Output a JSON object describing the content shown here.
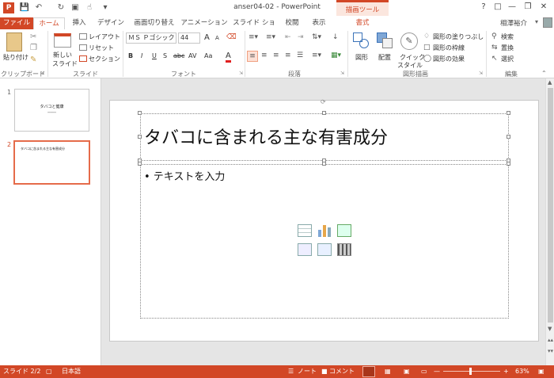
{
  "title": "anser04-02 - PowerPoint",
  "context_tab": "描画ツール",
  "tabs": [
    "ファイル",
    "ホーム",
    "挿入",
    "デザイン",
    "画面切り替え",
    "アニメーション",
    "スライド ショー",
    "校閲",
    "表示",
    "書式"
  ],
  "user": "相澤裕介",
  "ribbon": {
    "clipboard": {
      "paste": "貼り付け",
      "label": "クリップボード"
    },
    "slides": {
      "new_slide_1": "新しい",
      "new_slide_2": "スライド",
      "layout": "レイアウト",
      "reset": "リセット",
      "section": "セクション",
      "label": "スライド"
    },
    "font": {
      "font_name": "ＭＳ Ｐゴシック",
      "font_size": "44",
      "bold": "B",
      "italic": "I",
      "underline": "U",
      "shadow": "S",
      "strike": "abc",
      "spacing": "AV",
      "case": "Aa",
      "color": "A",
      "grow": "A",
      "shrink": "A",
      "label": "フォント"
    },
    "paragraph": {
      "label": "段落"
    },
    "drawing": {
      "shapes": "図形",
      "arrange": "配置",
      "quick_1": "クイック",
      "quick_2": "スタイル",
      "fill": "図形の塗りつぶし",
      "outline": "図形の枠線",
      "effect": "図形の効果",
      "label": "図形描画"
    },
    "editing": {
      "find": "検索",
      "replace": "置換",
      "select": "選択",
      "label": "編集"
    }
  },
  "slides": [
    {
      "num": "1",
      "title": "タバコと健康",
      "sub": "━━━━━━"
    },
    {
      "num": "2",
      "title": "タバコに含まれる主な有害成分"
    }
  ],
  "slide": {
    "title": "タバコに含まれる主な有害成分",
    "body": "• テキストを入力"
  },
  "status": {
    "slide": "スライド 2/2",
    "lang": "日本語",
    "notes": "ノート",
    "comments": "コメント",
    "zoom": "63%"
  },
  "colors": {
    "accent": "#d24726"
  }
}
